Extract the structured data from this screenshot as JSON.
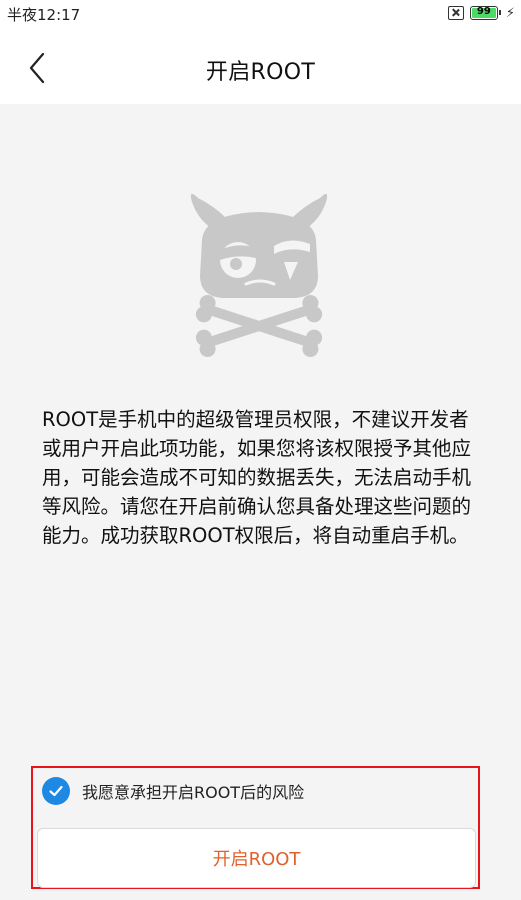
{
  "status_bar": {
    "time": "半夜12:17",
    "battery_level": "99",
    "icons": [
      "sim-card-icon",
      "battery-icon",
      "charging-bolt-icon"
    ]
  },
  "header": {
    "title": "开启ROOT",
    "back_icon": "back-chevron-icon"
  },
  "illustration": {
    "icon": "mi-bunny-skull-crossbones-icon"
  },
  "description": "ROOT是手机中的超级管理员权限，不建议开发者或用户开启此项功能，如果您将该权限授予其他应用，可能会造成不可知的数据丢失，无法启动手机等风险。请您在开启前确认您具备处理这些问题的能力。成功获取ROOT权限后，将自动重启手机。",
  "agreement": {
    "checked": true,
    "label": "我愿意承担开启ROOT后的风险"
  },
  "actions": {
    "enable_root_label": "开启ROOT"
  },
  "colors": {
    "accent_text": "#e0612c",
    "checkbox": "#1e88e5",
    "highlight_border": "#e8141b",
    "battery": "#4cd964",
    "mascot": "#c8c8c8"
  }
}
